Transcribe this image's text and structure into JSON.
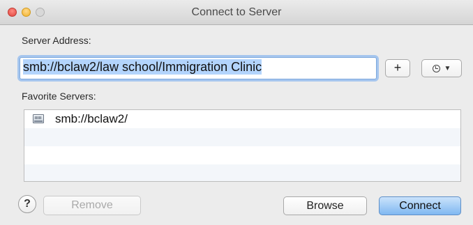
{
  "window": {
    "title": "Connect to Server"
  },
  "server_address": {
    "label": "Server Address:",
    "value": "smb://bclaw2/law school/Immigration Clinic"
  },
  "toolbar": {
    "add_label": "+",
    "recent_icon": "clock-icon"
  },
  "favorites": {
    "label": "Favorite Servers:",
    "items": [
      {
        "label": "smb://bclaw2/",
        "icon": "server-icon"
      }
    ]
  },
  "buttons": {
    "help_label": "?",
    "remove_label": "Remove",
    "browse_label": "Browse",
    "connect_label": "Connect"
  },
  "colors": {
    "focus_ring": "#a6c6ee",
    "selection": "#b3d4fc",
    "default_button": "#7fb8f1",
    "close": "#e0443e",
    "minimize": "#f2b22c"
  }
}
